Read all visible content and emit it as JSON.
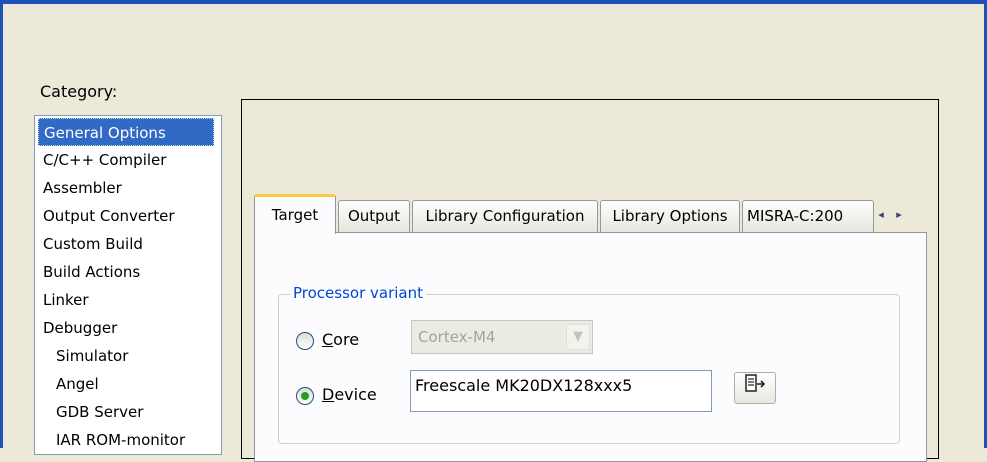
{
  "category_label": "Category:",
  "categories": [
    {
      "label": "General Options",
      "selected": true
    },
    {
      "label": "C/C++ Compiler"
    },
    {
      "label": "Assembler"
    },
    {
      "label": "Output Converter"
    },
    {
      "label": "Custom Build"
    },
    {
      "label": "Build Actions"
    },
    {
      "label": "Linker"
    },
    {
      "label": "Debugger"
    },
    {
      "label": "Simulator",
      "sub": true
    },
    {
      "label": "Angel",
      "sub": true
    },
    {
      "label": "GDB Server",
      "sub": true
    },
    {
      "label": "IAR ROM-monitor",
      "sub": true
    }
  ],
  "tabs": [
    {
      "label": "Target",
      "active": true
    },
    {
      "label": "Output"
    },
    {
      "label": "Library Configuration"
    },
    {
      "label": "Library Options"
    },
    {
      "label": "MISRA-C:200"
    }
  ],
  "tab_scroll": {
    "left_icon": "◂",
    "right_icon": "▸"
  },
  "processor_variant": {
    "title": "Processor variant",
    "core": {
      "label_prefix": "",
      "label_underlined": "C",
      "label_rest": "ore",
      "selected": false,
      "value": "Cortex-M4"
    },
    "device": {
      "label_prefix": "",
      "label_underlined": "D",
      "label_rest": "evice",
      "selected": true,
      "value": "Freescale MK20DX128xxx5"
    },
    "browse_icon": "device-browse-icon"
  },
  "colors": {
    "window_border": "#1f4fb8",
    "selection": "#316ac5",
    "group_title": "#0046d5",
    "tab_highlight": "#ffc83c",
    "radio_dot": "#21a121"
  }
}
